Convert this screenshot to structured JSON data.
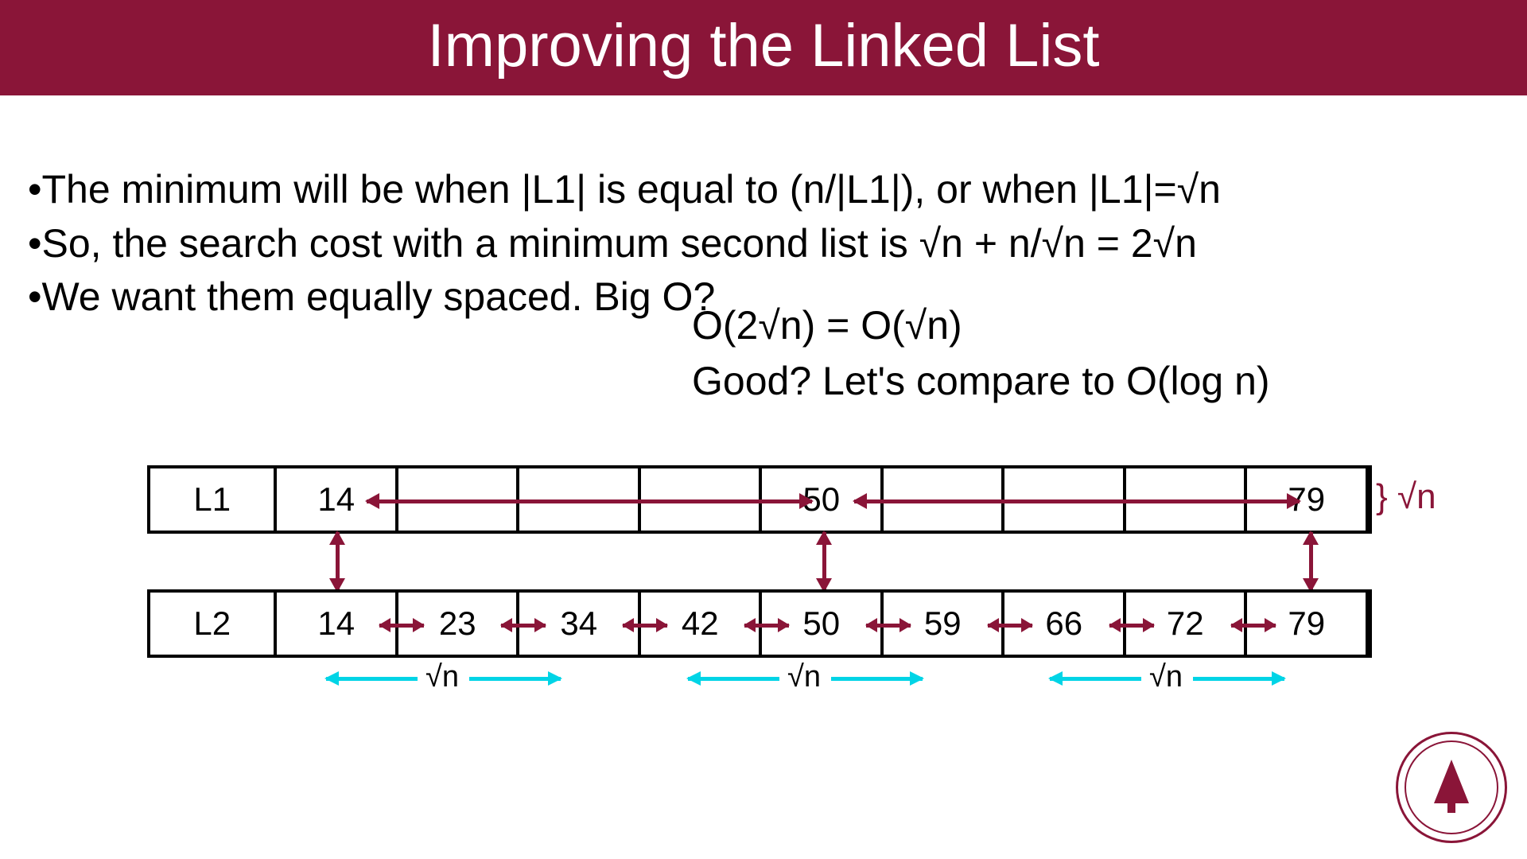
{
  "title": "Improving the Linked List",
  "bullets": {
    "b1": "•The minimum will be when |L1| is equal to (n/|L1|), or when |L1|=√n",
    "b2": "•So, the search cost with a minimum second list is √n + n/√n = 2√n",
    "b3": "•We want them equally spaced. Big O?"
  },
  "bigO": "O(2√n) = O(√n)",
  "good": "Good? Let's compare to O(log n)",
  "L1": {
    "label": "L1",
    "cells": [
      "14",
      "",
      "",
      "",
      "50",
      "",
      "",
      "",
      "79"
    ]
  },
  "L2": {
    "label": "L2",
    "cells": [
      "14",
      "23",
      "34",
      "42",
      "50",
      "59",
      "66",
      "72",
      "79"
    ]
  },
  "brace": "} √n",
  "sqrtn": "√n"
}
